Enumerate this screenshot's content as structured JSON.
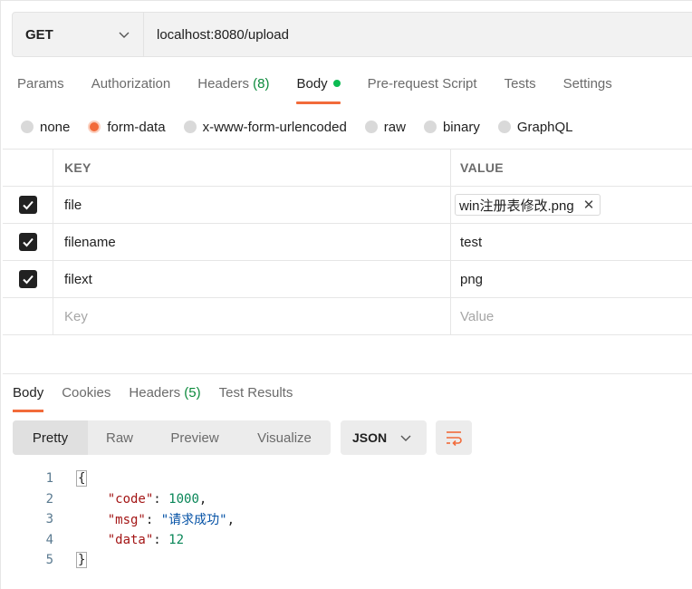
{
  "request": {
    "method": "GET",
    "url": "localhost:8080/upload"
  },
  "request_tabs": [
    {
      "label": "Params"
    },
    {
      "label": "Authorization"
    },
    {
      "label": "Headers",
      "count": "(8)"
    },
    {
      "label": "Body"
    },
    {
      "label": "Pre-request Script"
    },
    {
      "label": "Tests"
    },
    {
      "label": "Settings"
    }
  ],
  "body_types": [
    {
      "label": "none"
    },
    {
      "label": "form-data"
    },
    {
      "label": "x-www-form-urlencoded"
    },
    {
      "label": "raw"
    },
    {
      "label": "binary"
    },
    {
      "label": "GraphQL"
    }
  ],
  "selected_body_type": "form-data",
  "table": {
    "key_header": "KEY",
    "value_header": "VALUE",
    "rows": [
      {
        "key": "file",
        "value": "win注册表修改.png",
        "type": "file",
        "checked": true
      },
      {
        "key": "filename",
        "value": "test",
        "type": "text",
        "checked": true
      },
      {
        "key": "filext",
        "value": "png",
        "type": "text",
        "checked": true
      }
    ],
    "key_placeholder": "Key",
    "value_placeholder": "Value"
  },
  "response_tabs": [
    {
      "label": "Body"
    },
    {
      "label": "Cookies"
    },
    {
      "label": "Headers",
      "count": "(5)"
    },
    {
      "label": "Test Results"
    }
  ],
  "view_modes": [
    {
      "label": "Pretty"
    },
    {
      "label": "Raw"
    },
    {
      "label": "Preview"
    },
    {
      "label": "Visualize"
    }
  ],
  "format": "JSON",
  "response_body": {
    "line_numbers": [
      "1",
      "2",
      "3",
      "4",
      "5"
    ],
    "open_brace": "{",
    "close_brace": "}",
    "fields": [
      {
        "key": "\"code\"",
        "value": "1000",
        "kind": "number",
        "comma": ","
      },
      {
        "key": "\"msg\"",
        "value": "\"请求成功\"",
        "kind": "string",
        "comma": ","
      },
      {
        "key": "\"data\"",
        "value": "12",
        "kind": "number",
        "comma": ""
      }
    ]
  },
  "colors": {
    "accent": "#f26b3a",
    "active_dot": "#0cbb52",
    "count_green": "#0c8a3c"
  }
}
